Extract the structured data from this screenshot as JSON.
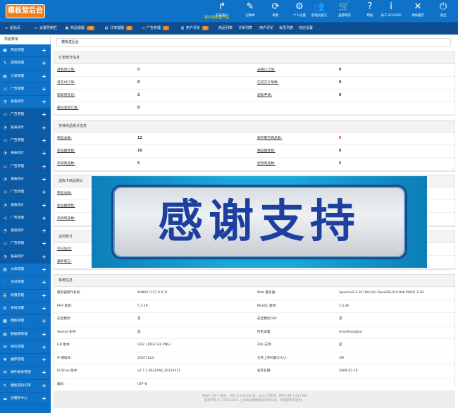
{
  "logo": "模板堂后台",
  "promo": "更多模板堂产品",
  "toolbar": [
    {
      "label": "开设商户",
      "icon": "↱"
    },
    {
      "label": "记事本",
      "icon": "✎"
    },
    {
      "label": "刷新",
      "icon": "⟳"
    },
    {
      "label": "个人设置",
      "icon": "⚙"
    },
    {
      "label": "管理员留言",
      "icon": "👥"
    },
    {
      "label": "查看网店",
      "icon": "🛒"
    },
    {
      "label": "帮助",
      "icon": "?"
    },
    {
      "label": "关于 ECSHOP",
      "icon": "i"
    },
    {
      "label": "清除缓存",
      "icon": "✕"
    },
    {
      "label": "退出",
      "icon": "⏻"
    }
  ],
  "menubar": [
    {
      "label": "起始页",
      "icon": "⌂"
    },
    {
      "label": "设置导航栏",
      "icon": "▭"
    },
    {
      "label": "商品提醒",
      "icon": "▦",
      "badge": "16"
    },
    {
      "label": "订单提醒",
      "icon": "▤",
      "badge": "0"
    },
    {
      "label": "广告管理",
      "icon": "◁",
      "badge": "1"
    },
    {
      "label": "用户评论",
      "icon": "▥",
      "badge": "0"
    },
    {
      "label": "商品列表"
    },
    {
      "label": "订单列表"
    },
    {
      "label": "用户评论"
    },
    {
      "label": "会员列表"
    },
    {
      "label": "商店设置"
    }
  ],
  "sidebar": {
    "title": "导航菜单",
    "items": [
      {
        "label": "商品管理",
        "icon": "▦"
      },
      {
        "label": "促销管理",
        "icon": "ϟ"
      },
      {
        "label": "订单管理",
        "icon": "▤"
      },
      {
        "label": "广告管理",
        "icon": "◁"
      },
      {
        "label": "报表统计",
        "icon": "◔"
      },
      {
        "label": "广告管理",
        "icon": "◁"
      },
      {
        "label": "报表统计",
        "icon": "◔"
      },
      {
        "label": "广告管理",
        "icon": "◁"
      },
      {
        "label": "报表统计",
        "icon": "◔"
      },
      {
        "label": "广告管理",
        "icon": "◁"
      },
      {
        "label": "报表统计",
        "icon": "◔"
      },
      {
        "label": "广告管理",
        "icon": "◁"
      },
      {
        "label": "报表统计",
        "icon": "◔"
      },
      {
        "label": "广告管理",
        "icon": "◁"
      },
      {
        "label": "报表统计",
        "icon": "◔"
      },
      {
        "label": "广告管理",
        "icon": "◁"
      },
      {
        "label": "报表统计",
        "icon": "◔"
      },
      {
        "label": "文章管理",
        "icon": "▤"
      },
      {
        "label": "会员管理",
        "icon": "👤"
      },
      {
        "label": "权限管理",
        "icon": "🔒"
      },
      {
        "label": "系统设置",
        "icon": "⚙"
      },
      {
        "label": "模板管理",
        "icon": "▦"
      },
      {
        "label": "数据库管理",
        "icon": "▤"
      },
      {
        "label": "短信管理",
        "icon": "✉"
      },
      {
        "label": "推荐管理",
        "icon": "✚"
      },
      {
        "label": "邮件群发管理",
        "icon": "✉"
      },
      {
        "label": "模板堂知识库",
        "icon": "✎"
      },
      {
        "label": "云服务中心",
        "icon": "☁"
      }
    ]
  },
  "breadcrumb": "模板堂后台",
  "orders": {
    "title": "订单统计信息",
    "rows": [
      {
        "k1": "待发货订单:",
        "v1": "0",
        "k2": "未确认订单:",
        "v2": "0",
        "v1red": true
      },
      {
        "k1": "待支付订单:",
        "v1": "0",
        "k2": "已成交订单数:",
        "v2": "0"
      },
      {
        "k1": "新缺货登记:",
        "v1": "3",
        "k2": "退款申请:",
        "v2": "0"
      },
      {
        "k1": "部分发货订单:",
        "v1": "0",
        "k2": "",
        "v2": ""
      }
    ]
  },
  "goods": {
    "title": "实体商品统计信息",
    "rows": [
      {
        "k1": "商品总数:",
        "v1": "12",
        "k2": "库存警告商品数:",
        "v2": "0",
        "v2red": true
      },
      {
        "k1": "新品推荐数:",
        "v1": "10",
        "k2": "精品推荐数:",
        "v2": "0"
      },
      {
        "k1": "热销商品数:",
        "v1": "5",
        "k2": "促销商品数:",
        "v2": "5"
      }
    ]
  },
  "virtual": {
    "title": "虚拟卡商品统计",
    "rows": [
      {
        "k1": "商品总数:"
      },
      {
        "k1": "新品推荐数:"
      },
      {
        "k1": "热销商品数:"
      }
    ]
  },
  "visits": {
    "title": "访问统计",
    "rows": [
      {
        "k1": "今日访问:"
      },
      {
        "k1": "最新留言:"
      }
    ]
  },
  "system": {
    "title": "系统信息",
    "rows": [
      {
        "k1": "服务器操作系统:",
        "v1": "WINNT (127.0.0.1)",
        "k2": "Web 服务器:",
        "v2": "Apache/2.4.10 (Win32) OpenSSL/0.9.8zb PHP/5.3.29"
      },
      {
        "k1": "PHP 版本:",
        "v1": "5.3.29",
        "k2": "MySQL 版本:",
        "v2": "5.5.40"
      },
      {
        "k1": "安全模式:",
        "v1": "否",
        "k2": "安全模式GID:",
        "v2": "否"
      },
      {
        "k1": "Socket 支持:",
        "v1": "是",
        "k2": "时区设置:",
        "v2": "Asia/Shanghai"
      },
      {
        "k1": "GD 版本:",
        "v1": "GD2 ( JPEG GIF PNG)",
        "k2": "Zlib 支持:",
        "v2": "是"
      },
      {
        "k1": "IP 库版本:",
        "v1": "20071024",
        "k2": "文件上传的最大大小:",
        "v2": "2M"
      },
      {
        "k1": "ECShop 版本:",
        "v1": "v2.7.3 RELEASE 20120411",
        "k2": "安装日期:",
        "v2": "2009-07-10"
      },
      {
        "k1": "编码:",
        "v1": "UTF-8",
        "k2": "",
        "v2": ""
      }
    ]
  },
  "footer": {
    "line1": "共执行 29 个查询，用时 0.106293 秒，Gzip 已禁用，内存占用 3.534 MB",
    "line2": "版权所有 © 2005-2012 上海商派网络科技有限公司，并保留所有权利。"
  },
  "overlay_text": "感谢支持"
}
